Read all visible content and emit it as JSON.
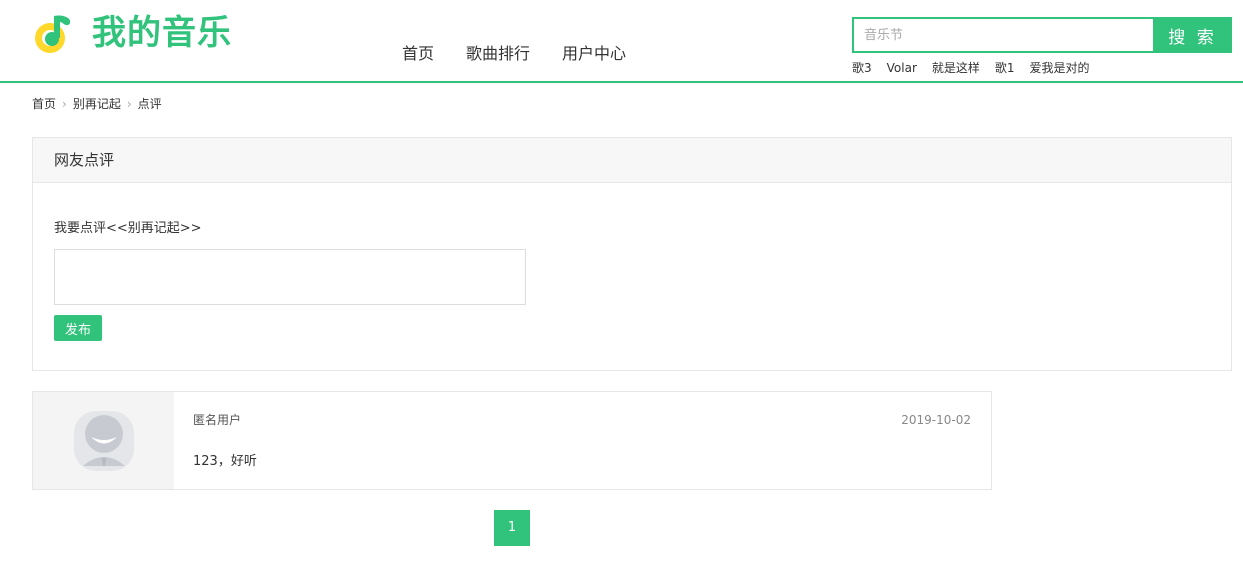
{
  "brand": {
    "name": "我的音乐",
    "accent_color": "#31c27c",
    "logo_icon": "music-note-logo-icon"
  },
  "nav": {
    "items": [
      {
        "label": "首页"
      },
      {
        "label": "歌曲排行"
      },
      {
        "label": "用户中心"
      }
    ]
  },
  "search": {
    "placeholder": "音乐节",
    "button_label": "搜 索",
    "hot_words": [
      "歌3",
      "Volar",
      "就是这样",
      "歌1",
      "爱我是对的"
    ]
  },
  "breadcrumb": {
    "items": [
      "首页",
      "别再记起"
    ],
    "current": "点评",
    "separator": "›"
  },
  "comment_form": {
    "panel_title": "网友点评",
    "label": "我要点评<<别再记起>>",
    "textarea_value": "",
    "submit_label": "发布"
  },
  "comments": [
    {
      "user": "匿名用户",
      "date": "2019-10-02",
      "text": "123，好听",
      "avatar_icon": "default-avatar-icon"
    }
  ],
  "pagination": {
    "pages": [
      "1"
    ],
    "current": "1"
  }
}
